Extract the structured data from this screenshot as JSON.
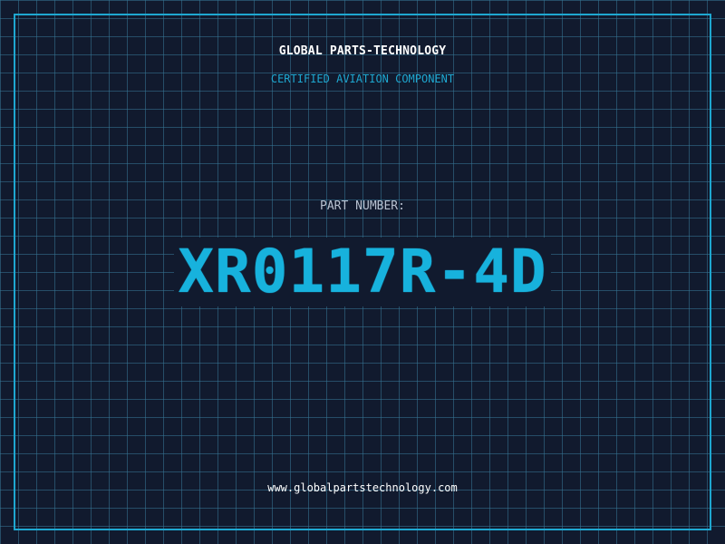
{
  "header": {
    "company_name": "GLOBAL PARTS-TECHNOLOGY",
    "subtitle": "CERTIFIED AVIATION COMPONENT"
  },
  "part": {
    "label": "PART NUMBER:",
    "number": "XR0117R-4D"
  },
  "footer": {
    "website": "www.globalpartstechnology.com"
  },
  "colors": {
    "background": "#111a2e",
    "grid": "#367696",
    "accent": "#1ea7d0",
    "part_number": "#17b2dd",
    "text_primary": "#ffffff",
    "text_secondary": "#b8c2d1"
  }
}
